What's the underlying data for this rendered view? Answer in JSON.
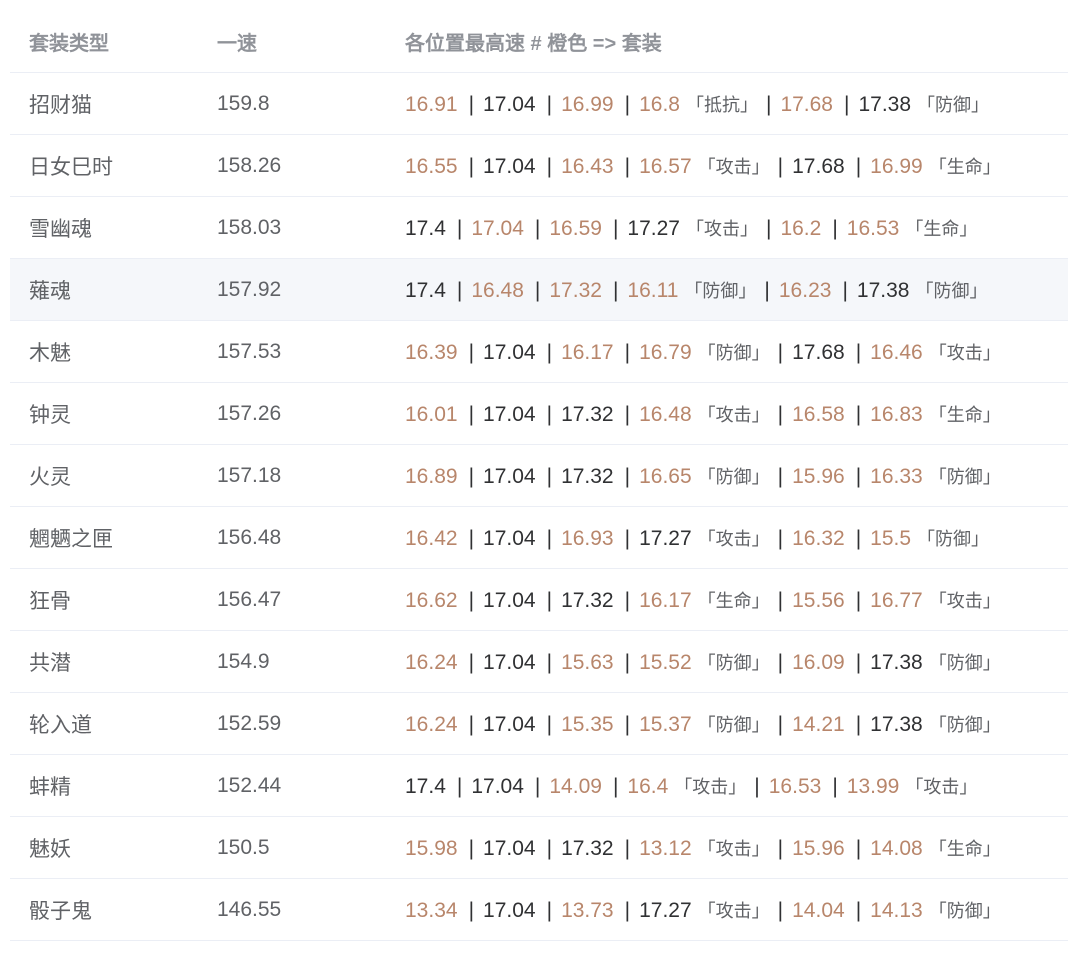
{
  "table": {
    "headers": [
      "套装类型",
      "一速",
      "各位置最高速 # 橙色 => 套装"
    ],
    "highlight_color": "#b8866b",
    "rows": [
      {
        "name": "招财猫",
        "speed": "159.8",
        "slots": [
          {
            "v": "16.91",
            "orange": true
          },
          {
            "v": "17.04",
            "orange": false
          },
          {
            "v": "16.99",
            "orange": true
          },
          {
            "v": "16.8",
            "orange": true,
            "attr": "「抵抗」"
          },
          {
            "v": "17.68",
            "orange": true
          },
          {
            "v": "17.38",
            "orange": false,
            "attr": "「防御」"
          }
        ]
      },
      {
        "name": "日女巳时",
        "speed": "158.26",
        "slots": [
          {
            "v": "16.55",
            "orange": true
          },
          {
            "v": "17.04",
            "orange": false
          },
          {
            "v": "16.43",
            "orange": true
          },
          {
            "v": "16.57",
            "orange": true,
            "attr": "「攻击」"
          },
          {
            "v": "17.68",
            "orange": false
          },
          {
            "v": "16.99",
            "orange": true,
            "attr": "「生命」"
          }
        ]
      },
      {
        "name": "雪幽魂",
        "speed": "158.03",
        "slots": [
          {
            "v": "17.4",
            "orange": false
          },
          {
            "v": "17.04",
            "orange": true
          },
          {
            "v": "16.59",
            "orange": true
          },
          {
            "v": "17.27",
            "orange": false,
            "attr": "「攻击」"
          },
          {
            "v": "16.2",
            "orange": true
          },
          {
            "v": "16.53",
            "orange": true,
            "attr": "「生命」"
          }
        ]
      },
      {
        "name": "薙魂",
        "speed": "157.92",
        "slots": [
          {
            "v": "17.4",
            "orange": false
          },
          {
            "v": "16.48",
            "orange": true
          },
          {
            "v": "17.32",
            "orange": true
          },
          {
            "v": "16.11",
            "orange": true,
            "attr": "「防御」"
          },
          {
            "v": "16.23",
            "orange": true
          },
          {
            "v": "17.38",
            "orange": false,
            "attr": "「防御」"
          }
        ]
      },
      {
        "name": "木魅",
        "speed": "157.53",
        "slots": [
          {
            "v": "16.39",
            "orange": true
          },
          {
            "v": "17.04",
            "orange": false
          },
          {
            "v": "16.17",
            "orange": true
          },
          {
            "v": "16.79",
            "orange": true,
            "attr": "「防御」"
          },
          {
            "v": "17.68",
            "orange": false
          },
          {
            "v": "16.46",
            "orange": true,
            "attr": "「攻击」"
          }
        ]
      },
      {
        "name": "钟灵",
        "speed": "157.26",
        "slots": [
          {
            "v": "16.01",
            "orange": true
          },
          {
            "v": "17.04",
            "orange": false
          },
          {
            "v": "17.32",
            "orange": false
          },
          {
            "v": "16.48",
            "orange": true,
            "attr": "「攻击」"
          },
          {
            "v": "16.58",
            "orange": true
          },
          {
            "v": "16.83",
            "orange": true,
            "attr": "「生命」"
          }
        ]
      },
      {
        "name": "火灵",
        "speed": "157.18",
        "slots": [
          {
            "v": "16.89",
            "orange": true
          },
          {
            "v": "17.04",
            "orange": false
          },
          {
            "v": "17.32",
            "orange": false
          },
          {
            "v": "16.65",
            "orange": true,
            "attr": "「防御」"
          },
          {
            "v": "15.96",
            "orange": true
          },
          {
            "v": "16.33",
            "orange": true,
            "attr": "「防御」"
          }
        ]
      },
      {
        "name": "魍魉之匣",
        "speed": "156.48",
        "slots": [
          {
            "v": "16.42",
            "orange": true
          },
          {
            "v": "17.04",
            "orange": false
          },
          {
            "v": "16.93",
            "orange": true
          },
          {
            "v": "17.27",
            "orange": false,
            "attr": "「攻击」"
          },
          {
            "v": "16.32",
            "orange": true
          },
          {
            "v": "15.5",
            "orange": true,
            "attr": "「防御」"
          }
        ]
      },
      {
        "name": "狂骨",
        "speed": "156.47",
        "slots": [
          {
            "v": "16.62",
            "orange": true
          },
          {
            "v": "17.04",
            "orange": false
          },
          {
            "v": "17.32",
            "orange": false
          },
          {
            "v": "16.17",
            "orange": true,
            "attr": "「生命」"
          },
          {
            "v": "15.56",
            "orange": true
          },
          {
            "v": "16.77",
            "orange": true,
            "attr": "「攻击」"
          }
        ]
      },
      {
        "name": "共潜",
        "speed": "154.9",
        "slots": [
          {
            "v": "16.24",
            "orange": true
          },
          {
            "v": "17.04",
            "orange": false
          },
          {
            "v": "15.63",
            "orange": true
          },
          {
            "v": "15.52",
            "orange": true,
            "attr": "「防御」"
          },
          {
            "v": "16.09",
            "orange": true
          },
          {
            "v": "17.38",
            "orange": false,
            "attr": "「防御」"
          }
        ]
      },
      {
        "name": "轮入道",
        "speed": "152.59",
        "slots": [
          {
            "v": "16.24",
            "orange": true
          },
          {
            "v": "17.04",
            "orange": false
          },
          {
            "v": "15.35",
            "orange": true
          },
          {
            "v": "15.37",
            "orange": true,
            "attr": "「防御」"
          },
          {
            "v": "14.21",
            "orange": true
          },
          {
            "v": "17.38",
            "orange": false,
            "attr": "「防御」"
          }
        ]
      },
      {
        "name": "蚌精",
        "speed": "152.44",
        "slots": [
          {
            "v": "17.4",
            "orange": false
          },
          {
            "v": "17.04",
            "orange": false
          },
          {
            "v": "14.09",
            "orange": true
          },
          {
            "v": "16.4",
            "orange": true,
            "attr": "「攻击」"
          },
          {
            "v": "16.53",
            "orange": true
          },
          {
            "v": "13.99",
            "orange": true,
            "attr": "「攻击」"
          }
        ]
      },
      {
        "name": "魅妖",
        "speed": "150.5",
        "slots": [
          {
            "v": "15.98",
            "orange": true
          },
          {
            "v": "17.04",
            "orange": false
          },
          {
            "v": "17.32",
            "orange": false
          },
          {
            "v": "13.12",
            "orange": true,
            "attr": "「攻击」"
          },
          {
            "v": "15.96",
            "orange": true
          },
          {
            "v": "14.08",
            "orange": true,
            "attr": "「生命」"
          }
        ]
      },
      {
        "name": "骰子鬼",
        "speed": "146.55",
        "slots": [
          {
            "v": "13.34",
            "orange": true
          },
          {
            "v": "17.04",
            "orange": false
          },
          {
            "v": "13.73",
            "orange": true
          },
          {
            "v": "17.27",
            "orange": false,
            "attr": "「攻击」"
          },
          {
            "v": "14.04",
            "orange": true
          },
          {
            "v": "14.13",
            "orange": true,
            "attr": "「防御」"
          }
        ]
      }
    ]
  }
}
